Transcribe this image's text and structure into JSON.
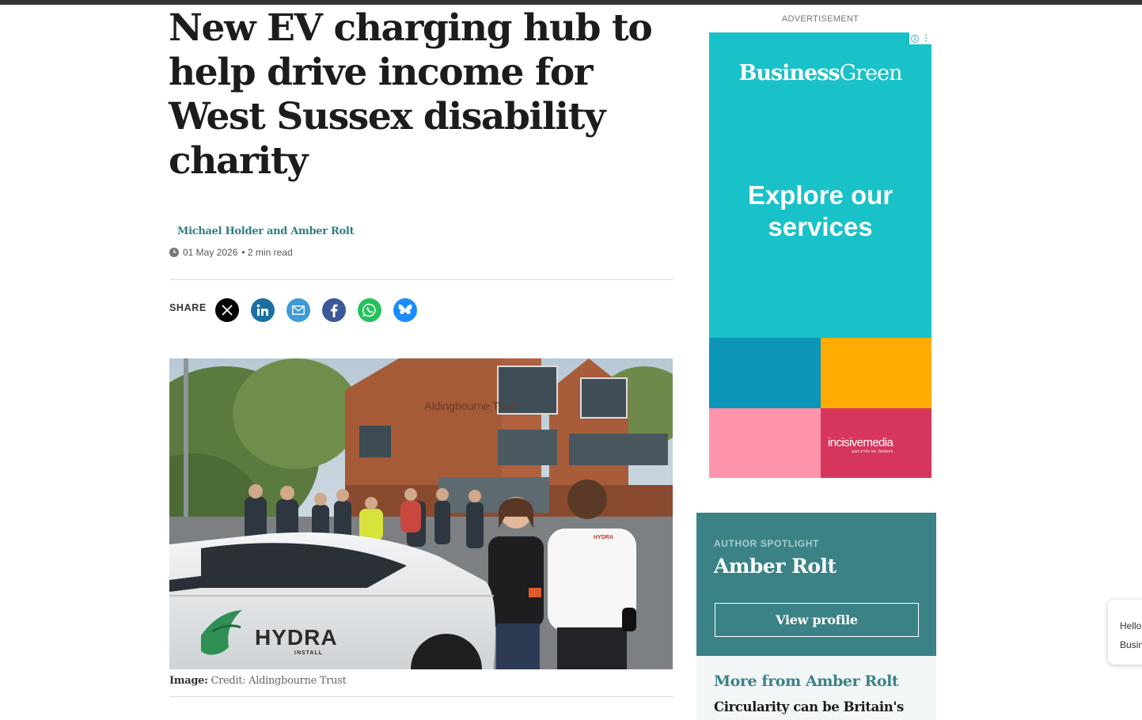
{
  "article": {
    "headline": "New EV charging hub to help drive income for West Sussex disability charity",
    "byline": "Michael Holder and Amber Rolt",
    "date": "01 May 2026",
    "read_time": "• 2 min read",
    "share_label": "SHARE",
    "share_buttons": [
      {
        "name": "x",
        "icon": "x-icon",
        "color": "#000000"
      },
      {
        "name": "linkedin",
        "icon": "linkedin-icon",
        "color": "#1c6fa3"
      },
      {
        "name": "email",
        "icon": "envelope-icon",
        "color": "#3d9ad6"
      },
      {
        "name": "facebook",
        "icon": "facebook-icon",
        "color": "#3b5998"
      },
      {
        "name": "whatsapp",
        "icon": "whatsapp-icon",
        "color": "#25c15a"
      },
      {
        "name": "bluesky",
        "icon": "butterfly-icon",
        "color": "#1a8cff"
      }
    ],
    "image": {
      "building_sign": "Aldingbourne Trust",
      "car_logo": "HYDRA",
      "car_logo_sub": "INSTALL",
      "shirt_logo": "HYDRA"
    },
    "caption_label": "Image:",
    "caption_text": "Credit: Aldingbourne Trust"
  },
  "ad": {
    "label": "ADVERTISEMENT",
    "brand_part1": "Business",
    "brand_part2": "Green",
    "cta": "Explore our services",
    "sponsor_logo": "incisivemedia",
    "sponsor_tagline": "part of the Inc. Network",
    "colors": {
      "background": "#19c1c8",
      "block_blue": "#0b96b9",
      "block_orange": "#ffab00",
      "block_pink": "#ff94ac",
      "block_crimson": "#d6365c"
    }
  },
  "spotlight": {
    "label": "AUTHOR SPOTLIGHT",
    "author": "Amber Rolt",
    "button": "View profile",
    "more_title": "More from Amber Rolt",
    "more_item": "Circularity can be Britain's"
  },
  "chat": {
    "line1": "Hello",
    "line2": "Busin"
  },
  "colors": {
    "accent_teal": "#3b8286",
    "byline": "#2f7e83"
  }
}
